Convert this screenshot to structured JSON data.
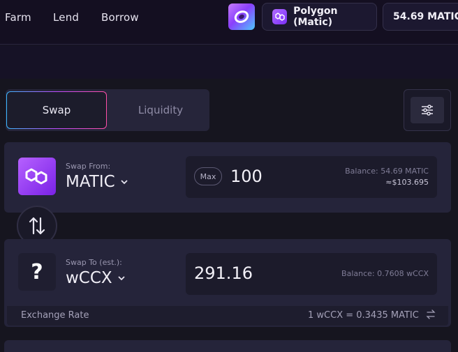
{
  "nav": {
    "items": [
      "Farm",
      "Lend",
      "Borrow"
    ]
  },
  "header": {
    "network_label": "Polygon (Matic)",
    "balance_label": "54.69 MATIC"
  },
  "tabs": {
    "swap": "Swap",
    "liquidity": "Liquidity",
    "active": "Swap"
  },
  "swap_from": {
    "label": "Swap From:",
    "token": "MATIC",
    "max_label": "Max",
    "amount": "100",
    "balance": "Balance: 54.69 MATIC",
    "usd_value": "≈$103.695"
  },
  "swap_to": {
    "label": "Swap To (est.):",
    "token": "wCCX",
    "logo_glyph": "?",
    "amount": "291.16",
    "balance": "Balance: 0.7608 wCCX"
  },
  "exchange": {
    "label": "Exchange Rate",
    "value": "1 wCCX = 0.3435 MATIC"
  },
  "icons": {
    "settings": "sliders-icon",
    "flip": "swap-arrows-icon",
    "rate_toggle": "arrows-exchange-icon",
    "dropdown": "chevron-down-icon"
  },
  "colors": {
    "accent_gradient": [
      "#3ab8ff",
      "#c04bff",
      "#ff4fa8"
    ],
    "polygon_purple": "#8a3ffc",
    "background": "#16151f",
    "card": "#25243a"
  }
}
